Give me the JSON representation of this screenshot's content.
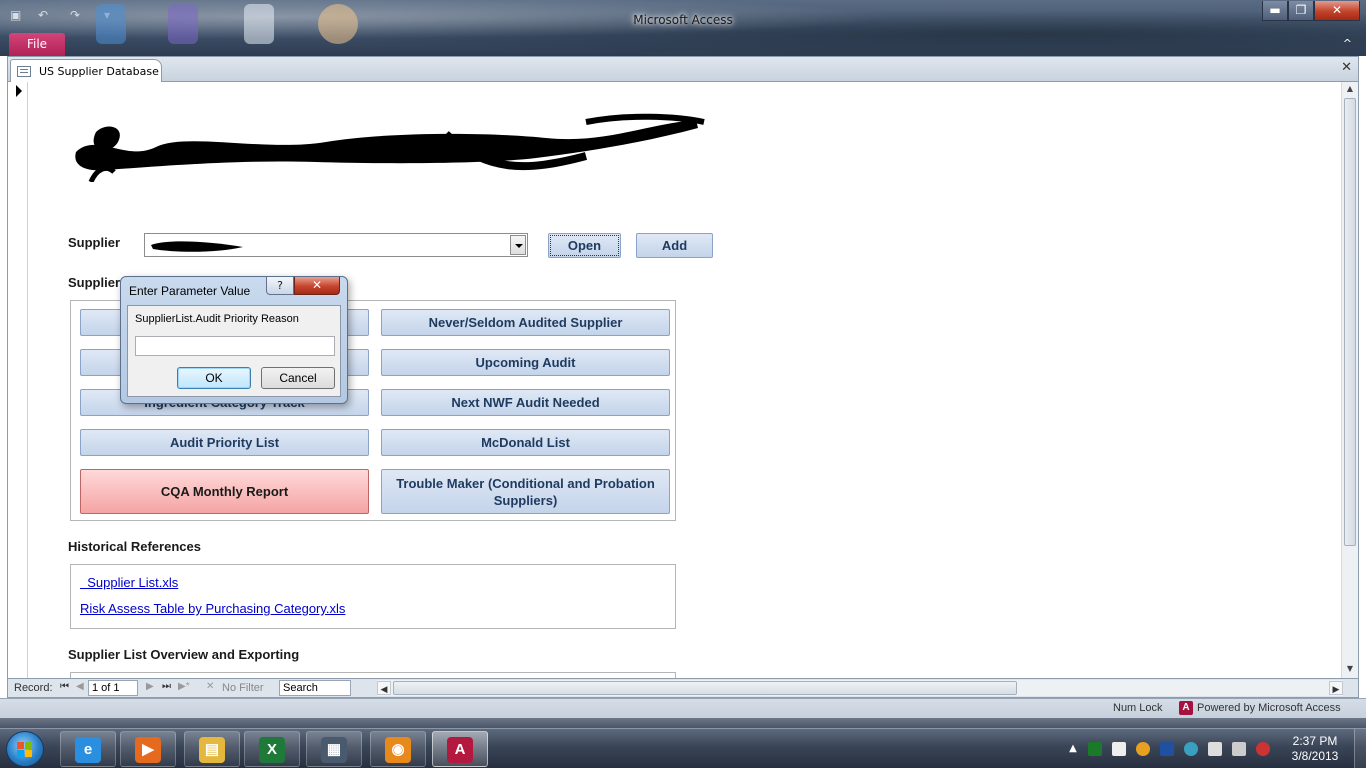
{
  "window": {
    "title": "Microsoft Access",
    "file_tab": "File",
    "minimize": "▬",
    "restore": "❐",
    "close": "✕",
    "ribbon_toggle": "^"
  },
  "document": {
    "tab_label": "US Supplier Database",
    "close": "✕"
  },
  "form": {
    "supplier_label": "Supplier",
    "open_button": "Open",
    "add_button": "Add",
    "supplier_section_label": "Supplier",
    "report_buttons": [
      "Never/Seldom Audited Supplier",
      "Upcoming Audit",
      "Ingredient Category Track",
      "Next NWF Audit Needed",
      "Audit Priority List",
      "McDonald List",
      "CQA Monthly Report",
      "Trouble Maker (Conditional and Probation Suppliers)"
    ],
    "historical_heading": "Historical References",
    "links": [
      "  Supplier List.xls",
      "Risk Assess Table by Purchasing Category.xls"
    ],
    "overview_heading": "Supplier List Overview and Exporting"
  },
  "dialog": {
    "title": "Enter Parameter Value",
    "help": "?",
    "close": "✕",
    "prompt": "SupplierList.Audit Priority Reason",
    "input_value": "",
    "ok": "OK",
    "cancel": "Cancel"
  },
  "navbar": {
    "record_label": "Record:",
    "first": "⏮",
    "prev": "◀",
    "record_value": "1 of 1",
    "next": "▶",
    "last": "⏭",
    "new": "▶*",
    "filter_icon": "✕",
    "filter_label": "No Filter",
    "search_placeholder": "Search",
    "scroll_left": "◀",
    "scroll_right": "▶"
  },
  "statusbar": {
    "num_lock": "Num Lock",
    "access_icon": "A",
    "powered_by": "Powered by Microsoft Access"
  },
  "taskbar": {
    "apps": [
      {
        "name": "Internet Explorer",
        "icon": "e",
        "color": "#2b8fe0"
      },
      {
        "name": "Windows Media Player",
        "icon": "▶",
        "color": "#e56a1e"
      },
      {
        "name": "Windows Explorer",
        "icon": "▤",
        "color": "#e4b83c"
      },
      {
        "name": "Microsoft Excel",
        "icon": "X",
        "color": "#1f7a3a"
      },
      {
        "name": "Remote Desktop",
        "icon": "▦",
        "color": "#4a5a6e"
      },
      {
        "name": "Lotus Notes",
        "icon": "◉",
        "color": "#e8891b"
      },
      {
        "name": "Microsoft Access",
        "icon": "A",
        "color": "#b3183f"
      }
    ],
    "tray_arrow": "▲",
    "clock_time": "2:37 PM",
    "clock_date": "3/8/2013"
  }
}
